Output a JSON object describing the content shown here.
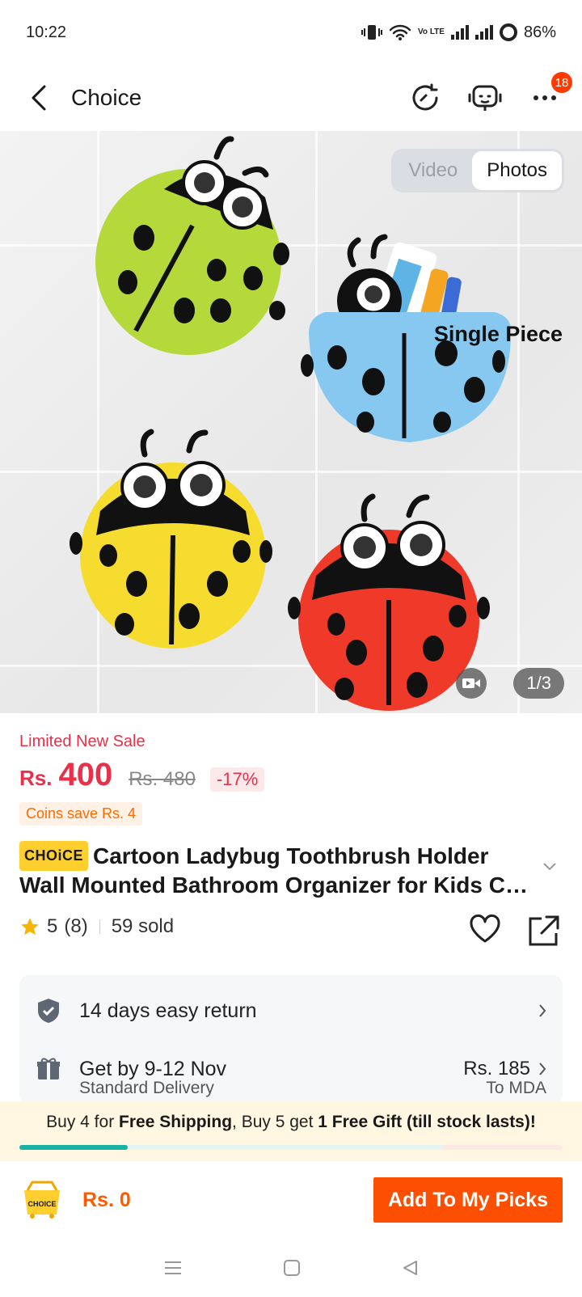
{
  "status_bar": {
    "time": "10:22",
    "volte": "Vo LTE",
    "battery": "86%"
  },
  "header": {
    "title": "Choice",
    "more_badge": "18"
  },
  "gallery": {
    "tabs": [
      "Video",
      "Photos"
    ],
    "active_tab": "Photos",
    "caption": "Single Piece",
    "counter": "1/3",
    "bug_colors": [
      "#b5d83b",
      "#86c8ef",
      "#f6dc2e",
      "#ef3a2a"
    ]
  },
  "product": {
    "sale_label": "Limited New Sale",
    "currency": "Rs.",
    "price": "400",
    "old_price": "Rs. 480",
    "discount": "-17%",
    "coins": "Coins save Rs. 4",
    "brand_logo": "CHOiCE",
    "title_line1": "Cartoon Ladybug Toothbrush Holder",
    "title_line2": "Wall Mounted Bathroom Organizer for Kids C…",
    "rating": "5",
    "reviews": "(8)",
    "sold": "59 sold"
  },
  "services": {
    "return_text": "14 days easy return",
    "delivery_text": "Get by 9-12 Nov",
    "delivery_price": "Rs. 185",
    "delivery_sub": "Standard Delivery",
    "delivery_to": "To MDA"
  },
  "promo": {
    "part1": "Buy 4 for ",
    "bold1": "Free Shipping",
    "part2": ", Buy 5 get ",
    "bold2": "1 Free Gift (till stock lasts)!",
    "progress": 0.2
  },
  "bottom": {
    "cart_label": "CHOICE",
    "total": "Rs. 0",
    "add_label": "Add To My Picks"
  },
  "colors": {
    "accent": "#fd4f01",
    "price_red": "#e8304a",
    "choice_yellow": "#ffcf2f",
    "progress_teal": "#18b1a3"
  }
}
